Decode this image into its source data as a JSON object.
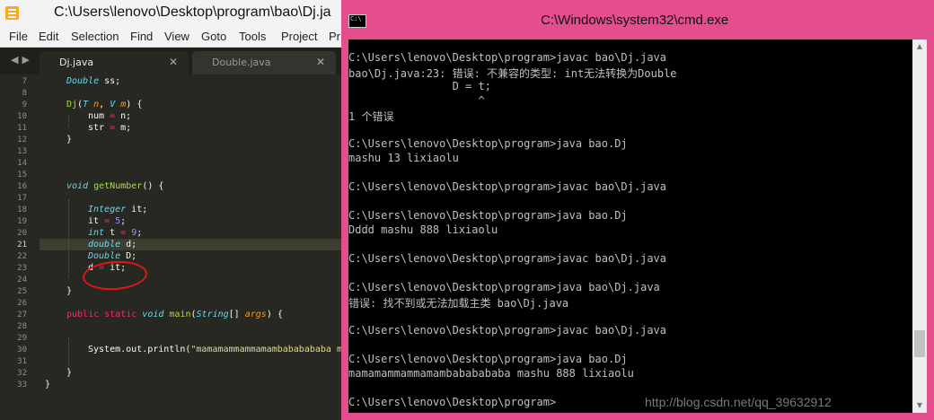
{
  "sublime": {
    "title": "C:\\Users\\lenovo\\Desktop\\program\\bao\\Dj.ja",
    "menu": [
      "File",
      "Edit",
      "Selection",
      "Find",
      "View",
      "Goto",
      "Tools",
      "Project",
      "Pr"
    ],
    "tabs": [
      {
        "label": "Dj.java",
        "active": true
      },
      {
        "label": "Double.java",
        "active": false
      }
    ],
    "line_numbers": [
      "7",
      "8",
      "9",
      "10",
      "11",
      "12",
      "13",
      "14",
      "15",
      "16",
      "17",
      "18",
      "19",
      "20",
      "21",
      "22",
      "23",
      "24",
      "25",
      "26",
      "27",
      "28",
      "29",
      "30",
      "31",
      "32",
      "33"
    ],
    "current_line": "21",
    "code": {
      "l7_type": "Double",
      "l7_rest": " ss;",
      "l9_name": "Dj",
      "l9_a": "(",
      "l9_t": "T",
      "l9_n": " n",
      "l9_comma": ", ",
      "l9_v": "V",
      "l9_m": " m",
      "l9_end": ") {",
      "l10_a": "num ",
      "l10_op": "=",
      "l10_b": " n;",
      "l11_a": "str ",
      "l11_op": "=",
      "l11_b": " m;",
      "l12": "}",
      "l16_void": "void",
      "l16_fn": " getNumber",
      "l16_end": "() {",
      "l18_type": "Integer",
      "l18_rest": " it;",
      "l19_a": "it ",
      "l19_op": "=",
      "l19_sp": " ",
      "l19_num": "5",
      "l19_end": ";",
      "l20_type": "int",
      "l20_a": " t ",
      "l20_op": "=",
      "l20_sp": " ",
      "l20_num": "9",
      "l20_end": ";",
      "l21_type": "double",
      "l21_rest": " d;",
      "l22_type": "Double",
      "l22_rest": " D;",
      "l23_a": "d ",
      "l23_op": "=",
      "l23_b": " it;",
      "l25": "}",
      "l27_public": "public",
      "l27_static": " static",
      "l27_void": " void",
      "l27_main": " main",
      "l27_a": "(",
      "l27_string": "String",
      "l27_b": "[] ",
      "l27_args": "args",
      "l27_end": ") {",
      "l30_a": "System.out.println(",
      "l30_str": "\"mamamammammamambababababa mas",
      "l32": "}",
      "l33": "}"
    }
  },
  "cmd": {
    "title": "C:\\Windows\\system32\\cmd.exe",
    "lines": [
      "C:\\Users\\lenovo\\Desktop\\program>javac bao\\Dj.java",
      "bao\\Dj.java:23: 错误: 不兼容的类型: int无法转换为Double",
      "                D = t;",
      "                    ^",
      "1 个错误",
      "",
      "C:\\Users\\lenovo\\Desktop\\program>java bao.Dj",
      "mashu 13 lixiaolu",
      "",
      "C:\\Users\\lenovo\\Desktop\\program>javac bao\\Dj.java",
      "",
      "C:\\Users\\lenovo\\Desktop\\program>java bao.Dj",
      "Dddd mashu 888 lixiaolu",
      "",
      "C:\\Users\\lenovo\\Desktop\\program>javac bao\\Dj.java",
      "",
      "C:\\Users\\lenovo\\Desktop\\program>java bao\\Dj.java",
      "错误: 找不到或无法加载主类 bao\\Dj.java",
      "",
      "C:\\Users\\lenovo\\Desktop\\program>javac bao\\Dj.java",
      "",
      "C:\\Users\\lenovo\\Desktop\\program>java bao.Dj",
      "mamamammammamambababababa mashu 888 lixiaolu",
      "",
      "C:\\Users\\lenovo\\Desktop\\program>"
    ],
    "watermark": "http://blog.csdn.net/qq_39632912"
  },
  "colors": {
    "editor_bg": "#272822",
    "cmd_frame": "#e44d8e",
    "annotation": "#e2141c"
  }
}
